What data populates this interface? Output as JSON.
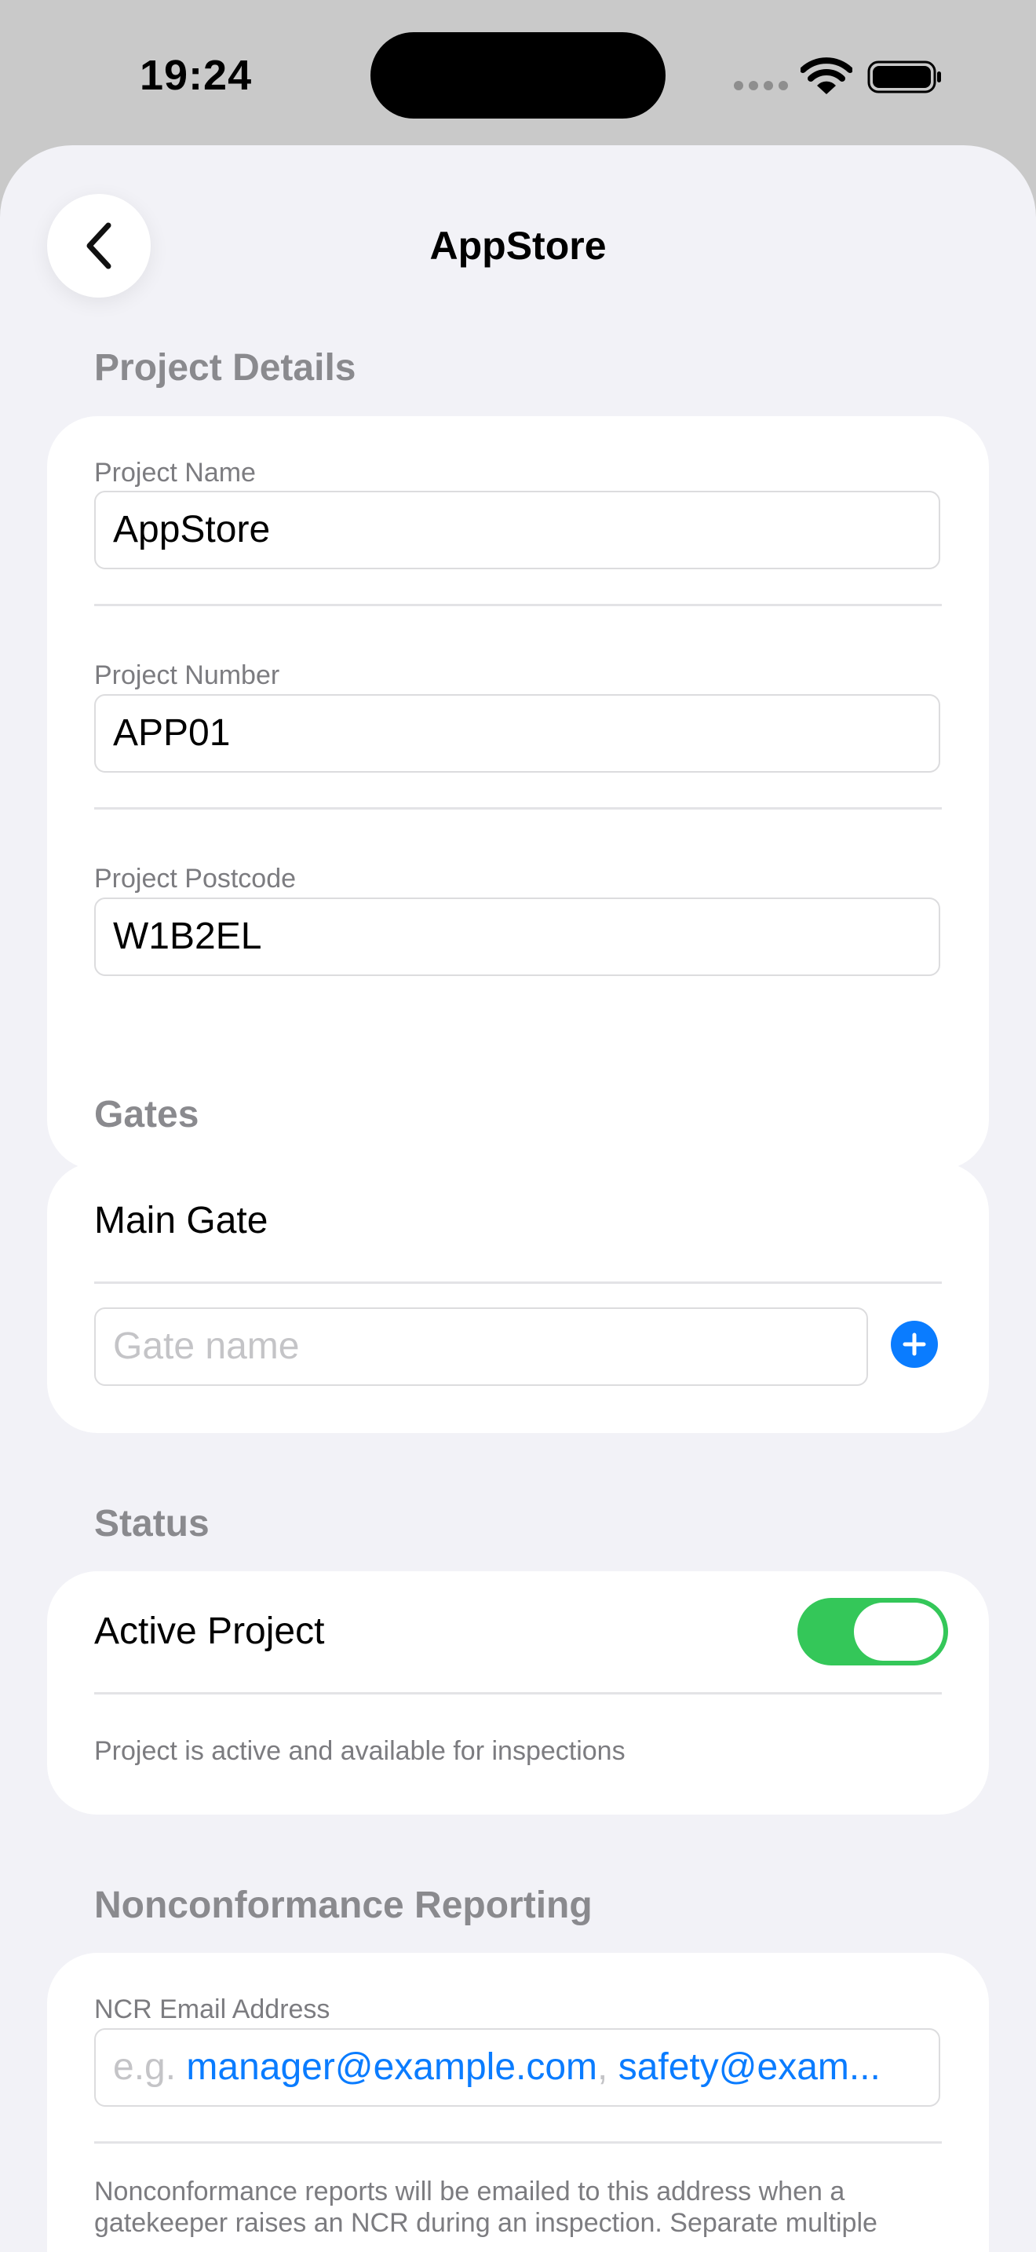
{
  "status_bar": {
    "time": "19:24"
  },
  "nav": {
    "title": "AppStore"
  },
  "project_details": {
    "header": "Project Details",
    "name_label": "Project Name",
    "name_value": "AppStore",
    "number_label": "Project Number",
    "number_value": "APP01",
    "postcode_label": "Project Postcode",
    "postcode_value": "W1B2EL"
  },
  "gates": {
    "header": "Gates",
    "items": [
      "Main Gate"
    ],
    "new_gate_placeholder": "Gate name"
  },
  "status": {
    "header": "Status",
    "active_label": "Active Project",
    "active_on": true,
    "footnote": "Project is active and available for inspections"
  },
  "ncr": {
    "header": "Nonconformance Reporting",
    "email_label": "NCR Email Address",
    "placeholder_prefix": "e.g. ",
    "placeholder_email_1": "manager@example.com",
    "placeholder_separator": ", ",
    "placeholder_email_2": "safety@exam...",
    "footnote_line_1": "Nonconformance reports will be emailed to this address when a",
    "footnote_line_2": "gatekeeper raises an NCR during an inspection. Separate multiple"
  },
  "colors": {
    "background": "#f2f2f7",
    "accent": "#0a7cff",
    "toggle_on": "#34c759",
    "secondary_text": "#8a8a8e"
  },
  "icons": {
    "back": "chevron-left-icon",
    "add": "plus-circle-icon",
    "wifi": "wifi-icon",
    "battery": "battery-icon",
    "signal": "cellular-signal-icon"
  }
}
